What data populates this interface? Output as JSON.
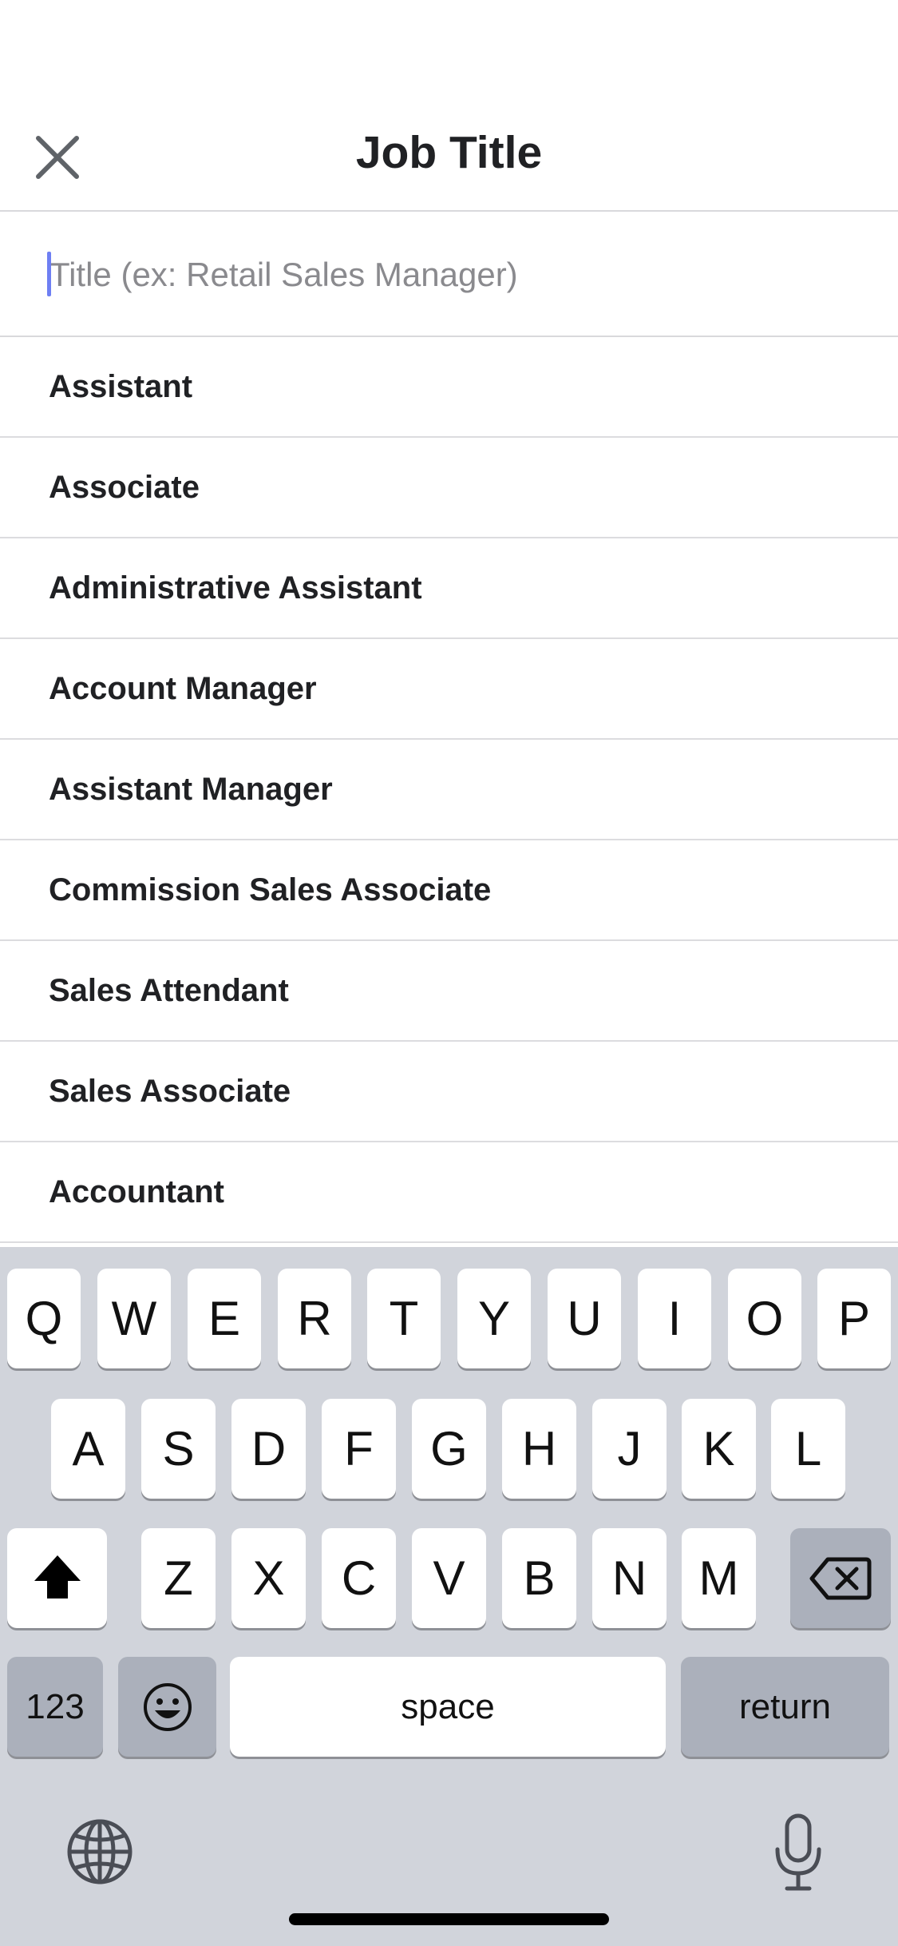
{
  "header": {
    "title": "Job Title",
    "close_icon": "close-icon"
  },
  "search": {
    "placeholder": "Title (ex: Retail Sales Manager)",
    "value": ""
  },
  "suggestions": [
    "Assistant",
    "Associate",
    "Administrative Assistant",
    "Account Manager",
    "Assistant Manager",
    "Commission Sales Associate",
    "Sales Attendant",
    "Sales Associate",
    "Accountant"
  ],
  "keyboard": {
    "row1": [
      "Q",
      "W",
      "E",
      "R",
      "T",
      "Y",
      "U",
      "I",
      "O",
      "P"
    ],
    "row2": [
      "A",
      "S",
      "D",
      "F",
      "G",
      "H",
      "J",
      "K",
      "L"
    ],
    "row3": [
      "Z",
      "X",
      "C",
      "V",
      "B",
      "N",
      "M"
    ],
    "numbers_label": "123",
    "space_label": "space",
    "return_label": "return",
    "icons": {
      "shift": "shift-icon",
      "delete": "delete-icon",
      "emoji": "emoji-icon",
      "globe": "globe-icon",
      "mic": "microphone-icon"
    },
    "colors": {
      "background": "#d1d4db",
      "key": "#ffffff",
      "dark_key": "#abb0bb"
    }
  },
  "colors": {
    "caret": "#6e7ff3",
    "divider": "#d9d9dc",
    "text": "#202124",
    "placeholder": "#8a8a8e"
  }
}
